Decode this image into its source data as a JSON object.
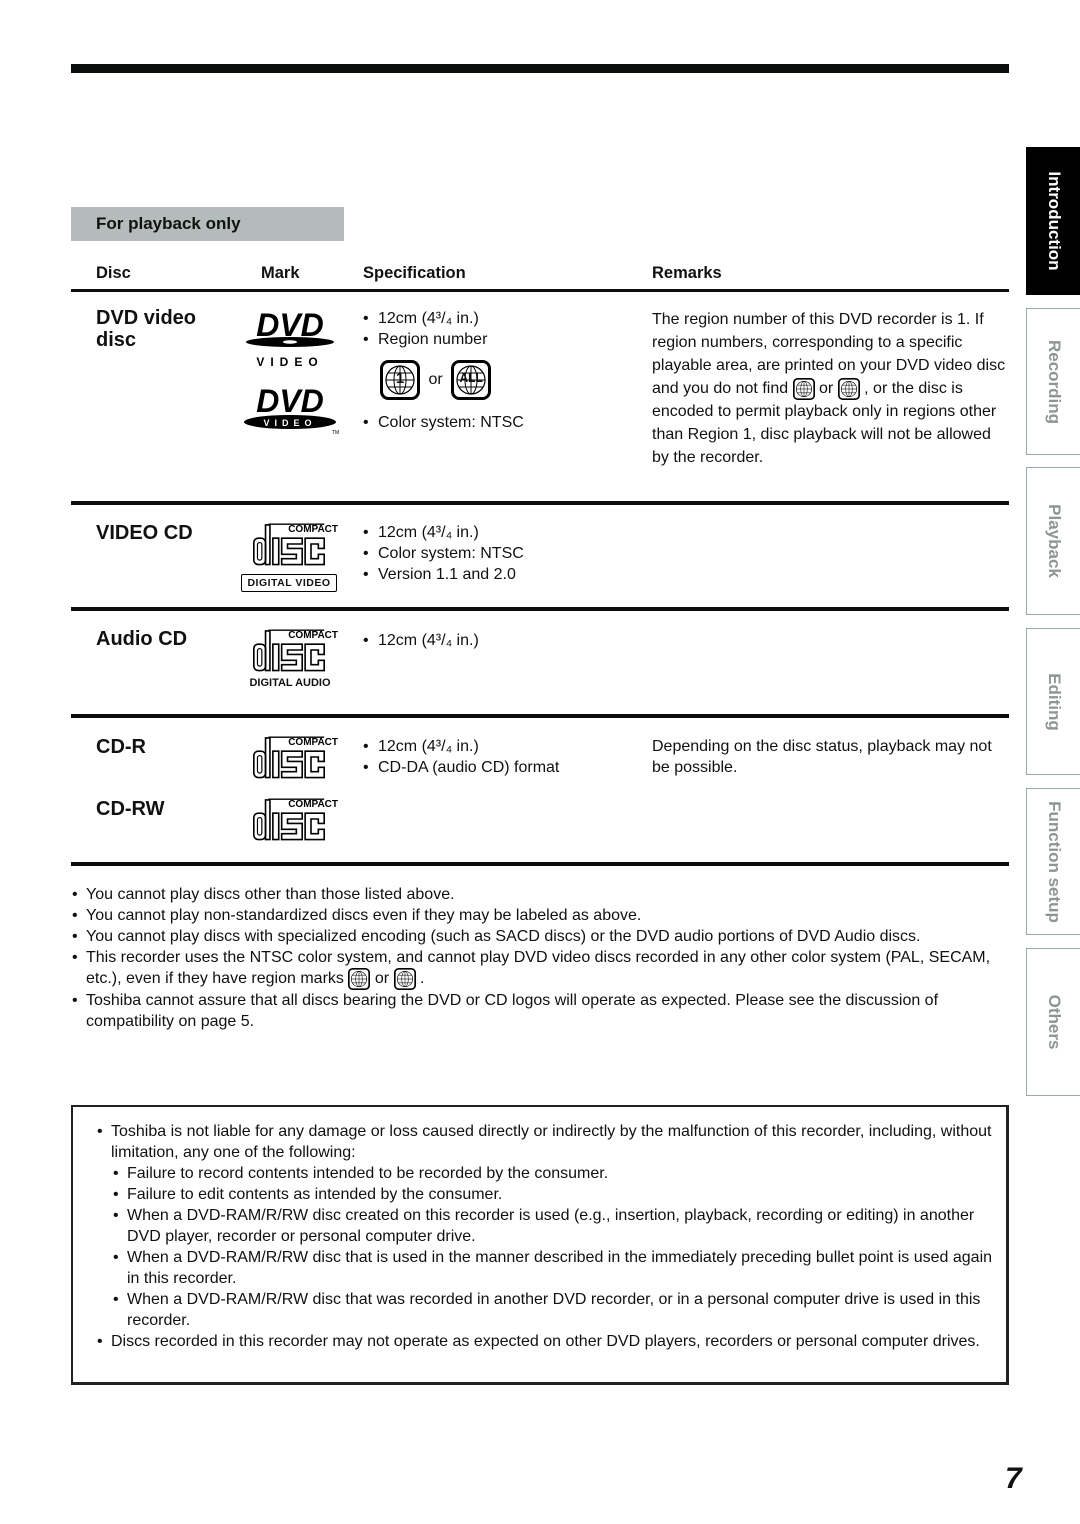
{
  "section_label": "For playback only",
  "table": {
    "headers": {
      "disc": "Disc",
      "mark": "Mark",
      "specification": "Specification",
      "remarks": "Remarks"
    },
    "rows": [
      {
        "disc": [
          "DVD video",
          "disc"
        ],
        "mark": "dvd-video-logo",
        "spec": [
          "12cm (4³/₄ in.)",
          "Region number",
          "Color system: NTSC"
        ],
        "region_or": "or",
        "region_marks": [
          "1",
          "ALL"
        ],
        "remarks": {
          "part1": "The region number of this DVD recorder is 1. If region numbers, corresponding to a specific playable area, are printed on your DVD video disc and you do not find",
          "or": "or",
          "part2": ", or the disc is encoded to permit playback only in regions other than Region 1, disc playback will not be allowed by the recorder."
        }
      },
      {
        "disc": [
          "VIDEO CD"
        ],
        "mark": "compact-disc-digital-video-logo",
        "mark_caption": "DIGITAL VIDEO",
        "spec": [
          "12cm (4³/₄ in.)",
          "Color system: NTSC",
          "Version 1.1 and 2.0"
        ],
        "remarks": ""
      },
      {
        "disc": [
          "Audio CD"
        ],
        "mark": "compact-disc-digital-audio-logo",
        "mark_caption": "DIGITAL AUDIO",
        "spec": [
          "12cm (4³/₄ in.)"
        ],
        "remarks": ""
      },
      {
        "disc": [
          "CD-R",
          "CD-RW"
        ],
        "mark": "compact-disc-logo",
        "spec": [
          "12cm (4³/₄ in.)",
          "CD-DA (audio CD) format"
        ],
        "remarks": "Depending on the disc status, playback may not be possible."
      }
    ]
  },
  "logo_text": {
    "compact": "COMPACT",
    "disc": "disc",
    "dvd": "DVD",
    "video": "VIDEO",
    "tm": "TM"
  },
  "notes": [
    "You cannot play discs other than those listed above.",
    "You cannot play non-standardized discs even if they may be labeled as above.",
    "You cannot play discs with specialized encoding (such as SACD discs) or the DVD audio portions of DVD Audio discs.",
    {
      "pre": "This recorder uses the NTSC color system, and cannot play DVD video discs recorded in any other color system (PAL, SECAM, etc.), even if they have region marks",
      "or": "or",
      "post": "."
    },
    "Toshiba cannot assure that all discs bearing the DVD or CD logos will operate as expected.  Please see the discussion of compatibility on page 5."
  ],
  "disclaimer": {
    "intro": "Toshiba is not liable for any damage or loss caused directly or indirectly by the malfunction of this recorder, including, without limitation, any one of the following:",
    "sub": [
      "Failure to record contents intended to be recorded by the consumer.",
      "Failure to edit contents as intended by the consumer.",
      "When a DVD-RAM/R/RW disc created on this recorder is used (e.g., insertion, playback, recording or editing) in another DVD player, recorder or personal computer drive.",
      "When a DVD-RAM/R/RW disc that is used in the manner described in the immediately preceding bullet point is used again in this recorder.",
      "When a DVD-RAM/R/RW disc that was recorded in another DVD recorder, or in a personal computer drive is used in this recorder."
    ],
    "last": "Discs recorded in this recorder may not operate as expected on other DVD players, recorders or personal computer drives."
  },
  "side_tabs": [
    {
      "label": "Introduction",
      "active": true
    },
    {
      "label": "Recording",
      "active": false
    },
    {
      "label": "Playback",
      "active": false
    },
    {
      "label": "Editing",
      "active": false
    },
    {
      "label": "Function setup",
      "active": false
    },
    {
      "label": "Others",
      "active": false
    }
  ],
  "page_number": "7"
}
